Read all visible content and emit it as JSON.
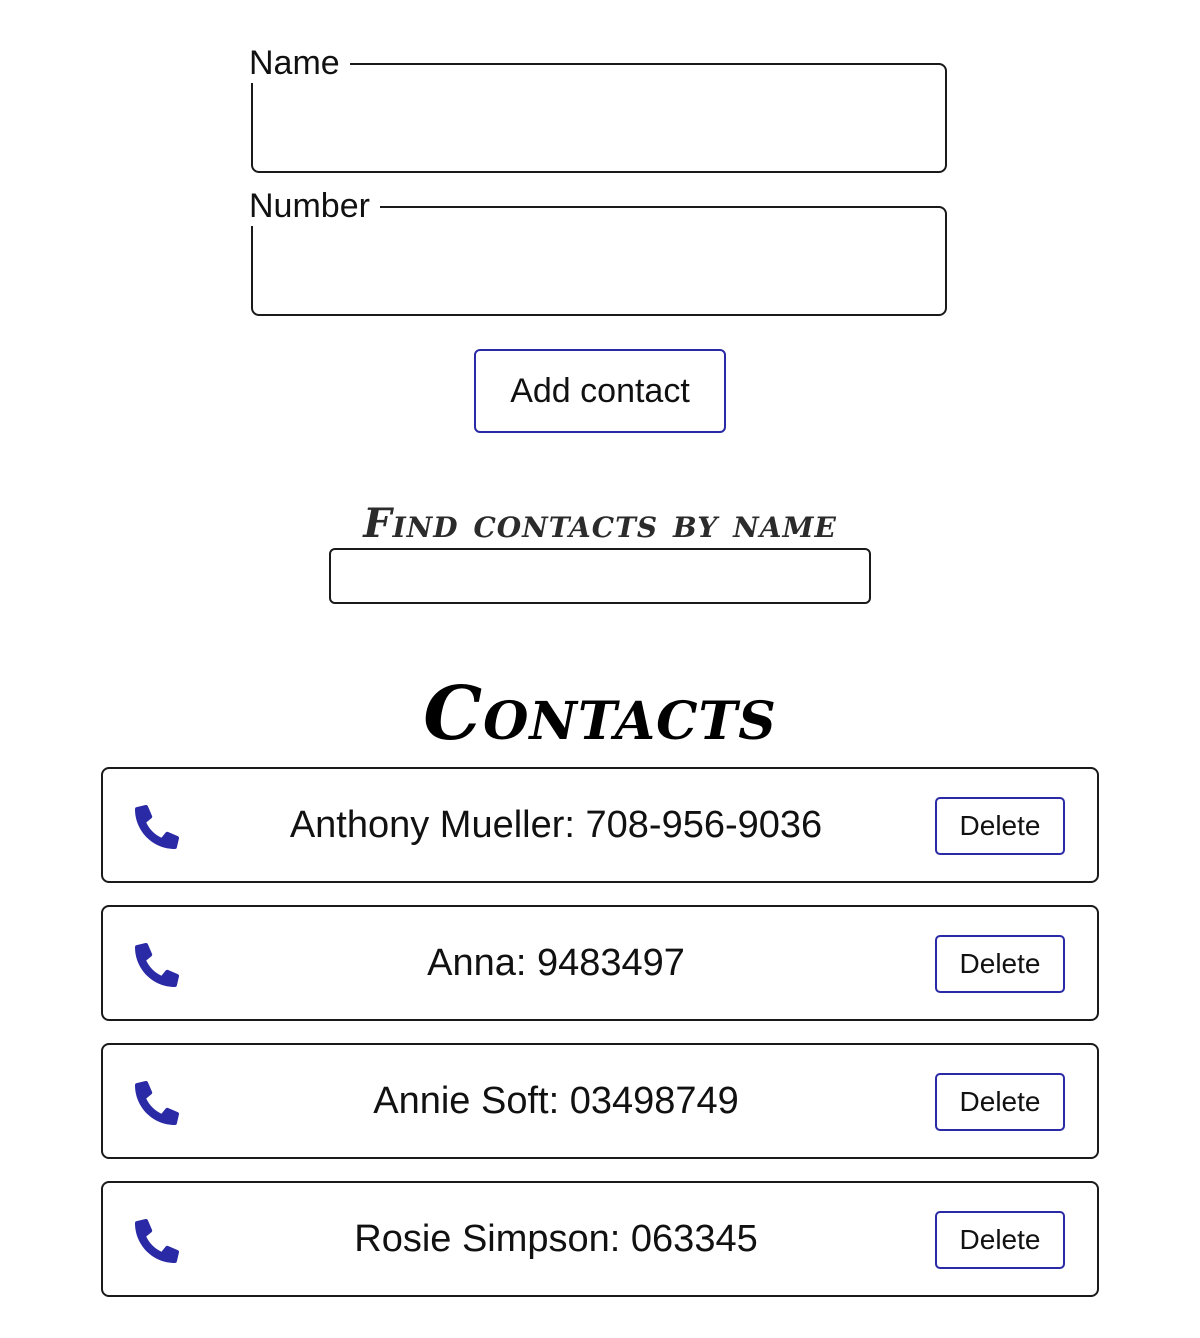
{
  "form": {
    "name_label": "Name",
    "name_value": "",
    "number_label": "Number",
    "number_value": "",
    "add_button_label": "Add contact"
  },
  "filter": {
    "label": "Find contacts by name",
    "value": ""
  },
  "contacts": {
    "title": "Contacts",
    "icon": "phone-icon",
    "accent_color": "#2a2aa6",
    "items": [
      {
        "text": "Anthony Mueller: 708-956-9036",
        "delete_label": "Delete"
      },
      {
        "text": "Anna: 9483497",
        "delete_label": "Delete"
      },
      {
        "text": "Annie Soft: 03498749",
        "delete_label": "Delete"
      },
      {
        "text": "Rosie Simpson: 063345",
        "delete_label": "Delete"
      }
    ]
  }
}
